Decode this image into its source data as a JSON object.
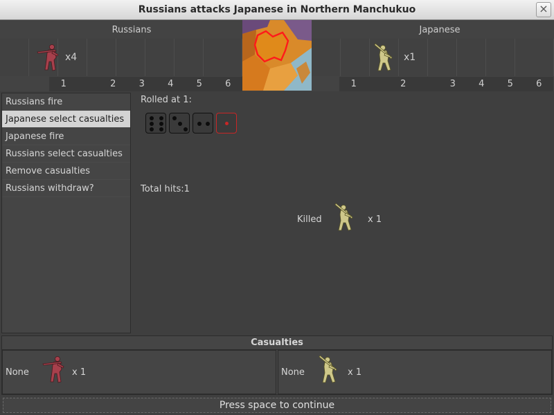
{
  "window": {
    "title": "Russians attacks Japanese in Northern Manchukuo",
    "close_glyph": "×"
  },
  "attacker": {
    "name": "Russians",
    "color": "#a7404c",
    "unit_count": "x4",
    "column_numbers": [
      "1",
      "2",
      "3",
      "4",
      "5",
      "6"
    ]
  },
  "defender": {
    "name": "Japanese",
    "color": "#cfc88a",
    "unit_count": "x1",
    "column_numbers": [
      "1",
      "2",
      "3",
      "4",
      "5",
      "6"
    ]
  },
  "steps": [
    {
      "label": "Russians fire",
      "active": false
    },
    {
      "label": "Japanese select casualties",
      "active": true
    },
    {
      "label": "Japanese fire",
      "active": false
    },
    {
      "label": "Russians select casualties",
      "active": false
    },
    {
      "label": "Remove casualties",
      "active": false
    },
    {
      "label": "Russians withdraw?",
      "active": false
    }
  ],
  "roll": {
    "label": "Rolled at 1:",
    "dice": [
      6,
      3,
      2,
      1
    ],
    "hit_die_color": "#c92626"
  },
  "total_hits": "Total hits:1",
  "killed": {
    "label": "Killed",
    "count": "x 1",
    "icon": "infantry-icon"
  },
  "casualties": {
    "title": "Casualties",
    "left": {
      "none_label": "None",
      "count": "x 1"
    },
    "right": {
      "none_label": "None",
      "count": "x 1"
    }
  },
  "continue": "Press space to continue"
}
